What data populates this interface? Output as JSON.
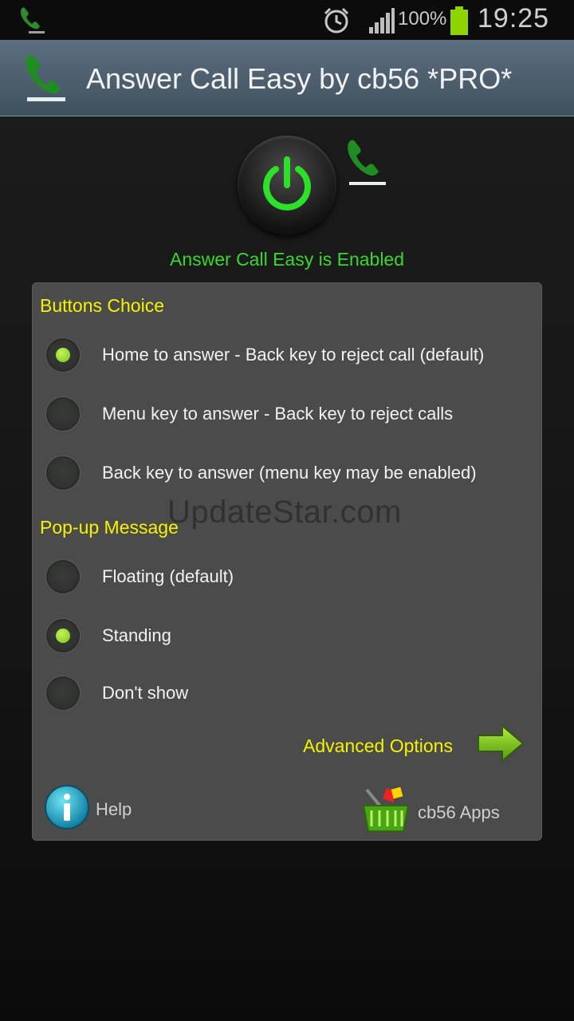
{
  "status_bar": {
    "battery_pct": "100%",
    "time": "19:25",
    "icons": [
      "phone-icon",
      "alarm-icon",
      "signal-icon",
      "battery-icon"
    ]
  },
  "app_bar": {
    "title": "Answer Call Easy by cb56 *PRO*",
    "icon": "phone-handset-icon"
  },
  "status": {
    "enabled_text": "Answer Call Easy is Enabled",
    "power_icon": "power-icon",
    "accent": "#39d82c"
  },
  "panel": {
    "buttons_choice": {
      "title": "Buttons Choice",
      "options": [
        {
          "label": "Home to answer - Back key to reject call (default)",
          "selected": true
        },
        {
          "label": "Menu key to answer - Back key to reject calls",
          "selected": false
        },
        {
          "label": "Back key to answer (menu key may be enabled)",
          "selected": false
        }
      ]
    },
    "popup_message": {
      "title": "Pop-up Message",
      "options": [
        {
          "label": "Floating (default)",
          "selected": false
        },
        {
          "label": "Standing",
          "selected": true
        },
        {
          "label": "Don't show",
          "selected": false
        }
      ]
    },
    "watermark": "UpdateStar.com",
    "advanced_label": "Advanced Options",
    "help_label": "Help",
    "apps_label": "cb56 Apps"
  },
  "colors": {
    "section_title": "#f5f300",
    "radio_selected": "#9be035",
    "panel_bg": "#4b4b4b"
  }
}
